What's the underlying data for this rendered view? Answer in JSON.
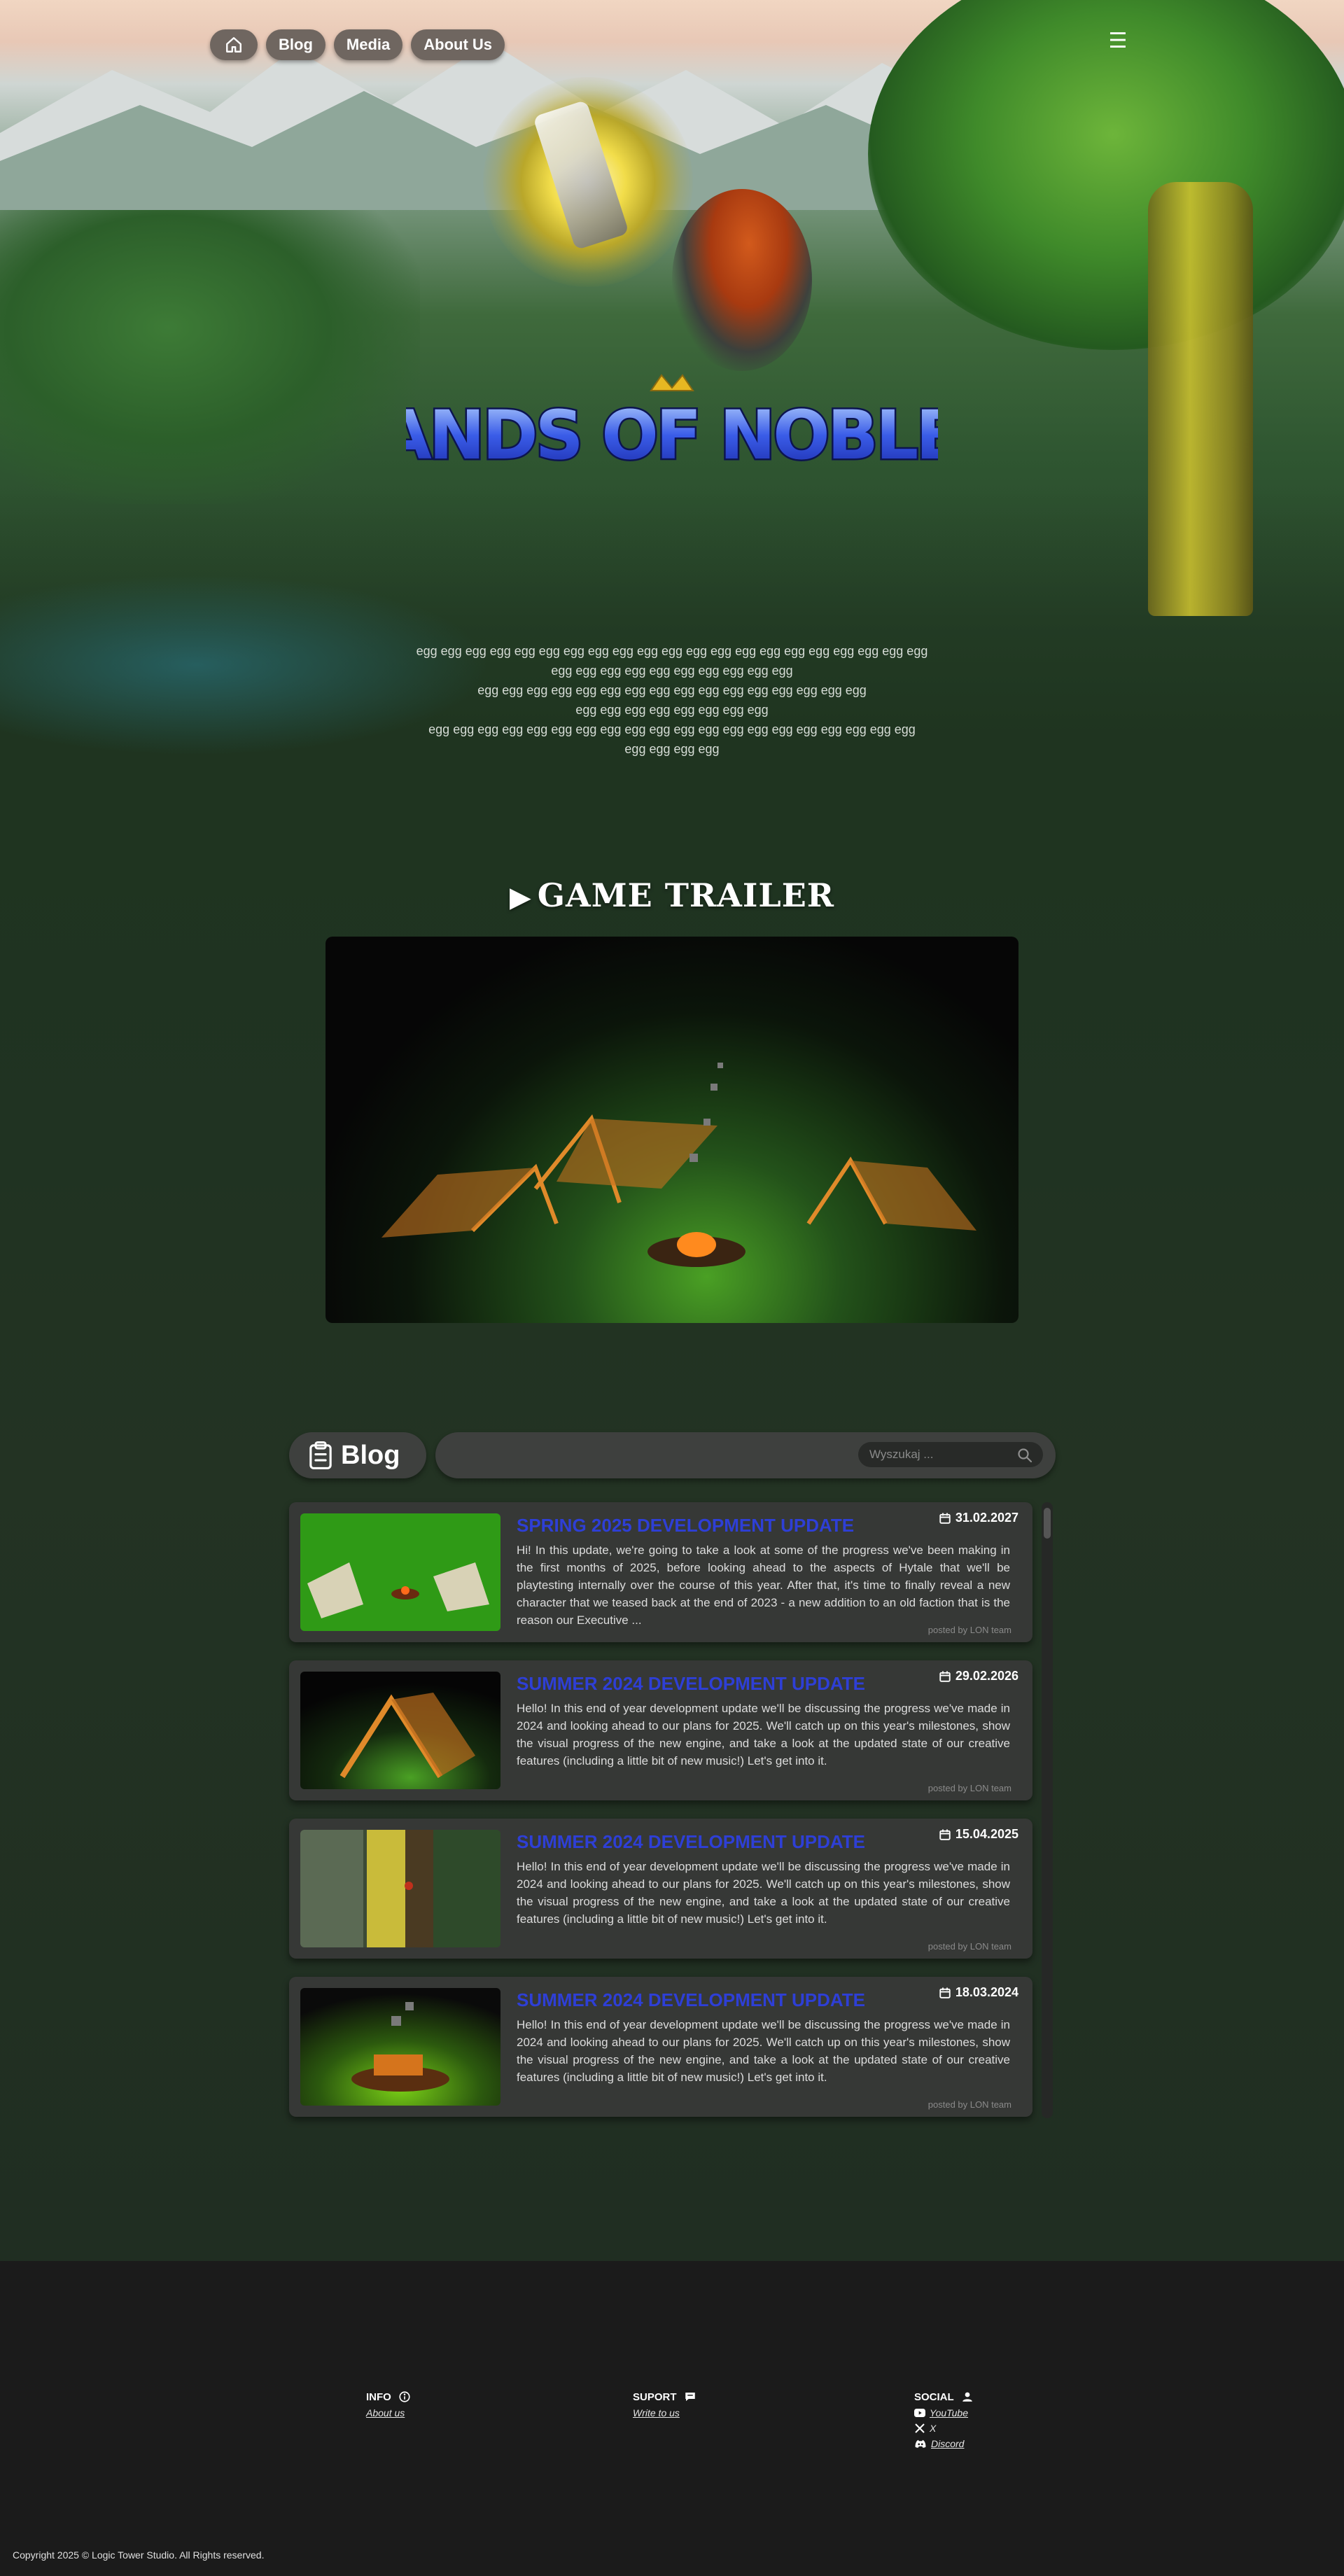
{
  "nav": {
    "home_label": "Home",
    "items": [
      {
        "label": "Blog"
      },
      {
        "label": "Media"
      },
      {
        "label": "About Us"
      }
    ],
    "menu_icon": "hamburger-icon"
  },
  "hero": {
    "logo_text": "LANDS OF NOBLES",
    "intro_lines": [
      "egg egg egg egg egg egg egg egg egg egg egg egg egg egg egg egg egg egg egg egg egg",
      "egg egg egg egg egg egg egg egg egg egg",
      "egg egg egg egg egg egg egg egg egg egg egg egg egg egg egg egg",
      "egg egg egg egg egg egg egg egg",
      "egg egg egg egg egg egg egg egg egg egg egg egg egg egg egg egg egg egg egg egg",
      "egg egg egg egg"
    ]
  },
  "trailer": {
    "title": "GAME TRAILER",
    "play_glyph": "▶"
  },
  "blog": {
    "title": "Blog",
    "search_placeholder": "Wyszukaj ...",
    "posts": [
      {
        "title": "SPRING 2025 DEVELOPMENT UPDATE",
        "date": "31.02.2027",
        "body": "Hi! In this update, we're going to take a look at some of the progress we've been making in the first months of 2025, before looking ahead to the aspects of Hytale that we'll be playtesting internally over the course of this year. After that, it's time to finally reveal a new character that we teased back at the end of 2023 - a new addition to an old faction that is the reason our Executive ...",
        "author": "posted by LON team",
        "thumb": "camp-day"
      },
      {
        "title": "SUMMER 2024 DEVELOPMENT UPDATE",
        "date": "29.02.2026",
        "body": "Hello! In this end of year development update we'll be discussing the progress we've made in 2024 and looking ahead to our plans for 2025. We'll catch up on this year's milestones, show the visual progress of the new engine, and take a look at the updated state of our creative features (including a little bit of new music!) Let's get into it.",
        "author": "posted by LON team",
        "thumb": "tent-night"
      },
      {
        "title": "SUMMER 2024 DEVELOPMENT UPDATE",
        "date": "15.04.2025",
        "body": "Hello! In this end of year development update we'll be discussing the progress we've made in 2024 and looking ahead to our plans for 2025. We'll catch up on this year's milestones, show the visual progress of the new engine, and take a look at the updated state of our creative features (including a little bit of new music!) Let's get into it.",
        "author": "posted by LON team",
        "thumb": "tree-trunk"
      },
      {
        "title": "SUMMER 2024 DEVELOPMENT UPDATE",
        "date": "18.03.2024",
        "body": "Hello! In this end of year development update we'll be discussing the progress we've made in 2024 and looking ahead to our plans for 2025. We'll catch up on this year's milestones, show the visual progress of the new engine, and take a look at the updated state of our creative features (including a little bit of new music!) Let's get into it.",
        "author": "posted by LON team",
        "thumb": "campfire"
      }
    ]
  },
  "footer": {
    "info": {
      "heading": "INFO",
      "link": "About us"
    },
    "support": {
      "heading": "SUPORT",
      "link": "Write to us"
    },
    "social": {
      "heading": "SOCIAL",
      "links": [
        "YouTube",
        "X",
        "Discord"
      ]
    },
    "copyright": "Copyright 2025 ©  Logic Tower Studio. All Rights reserved."
  },
  "colors": {
    "post_title": "#2e3fd6",
    "nav_pill": "#6f6660",
    "panel": "#363836",
    "footer_bg": "#1b1b1b"
  }
}
